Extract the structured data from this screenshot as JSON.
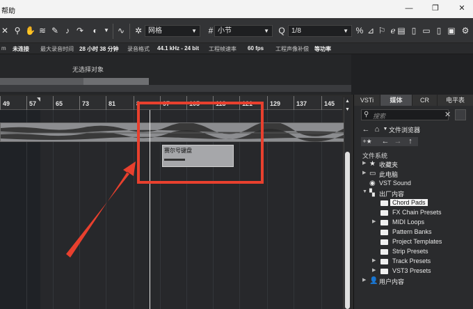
{
  "menubar": {
    "help": "帮助",
    "win_minimize": "—",
    "win_restore": "❐",
    "win_close": "✕"
  },
  "toolbar": {
    "snap_type": "网格",
    "grid_type": "小节",
    "quantize": "1/8"
  },
  "infobar": {
    "items": [
      {
        "label": "m",
        "value": ""
      },
      {
        "label": "未连接",
        "value": ""
      },
      {
        "label": "最大录音时间",
        "value": "28 小时 38 分钟"
      },
      {
        "label": "录音格式",
        "value": "44.1 kHz - 24 bit"
      },
      {
        "label": "工程帧速率",
        "value": "60 fps"
      },
      {
        "label": "工程声像补偿",
        "value": "等功率"
      }
    ]
  },
  "inspector": {
    "no_selection": "无选择对象"
  },
  "ruler": {
    "bars": [
      "49",
      "57",
      "65",
      "73",
      "81",
      "8",
      "97",
      "105",
      "113",
      "121",
      "129",
      "137",
      "145"
    ]
  },
  "arrange": {
    "midi_event_title": "赛尔号键盘"
  },
  "panel": {
    "tabs": [
      "VSTi",
      "媒体",
      "CR",
      "电平表"
    ],
    "search_placeholder": "搜索",
    "path_label": "文件浏览器",
    "section": "文件系统",
    "tree": [
      {
        "label": "收藏夹",
        "icon": "star-icon",
        "expanded": false,
        "level": 0
      },
      {
        "label": "此电脑",
        "icon": "computer-icon",
        "expanded": false,
        "level": 0
      },
      {
        "label": "VST Sound",
        "icon": "disc-icon",
        "expanded": null,
        "level": 0
      },
      {
        "label": "出厂内容",
        "icon": "factory-icon",
        "expanded": true,
        "level": 0
      },
      {
        "label": "Chord Pads",
        "icon": "folder-icon",
        "expanded": null,
        "level": 1,
        "selected": true
      },
      {
        "label": "FX Chain Presets",
        "icon": "folder-icon",
        "expanded": null,
        "level": 1
      },
      {
        "label": "MIDI Loops",
        "icon": "folder-icon",
        "expanded": false,
        "level": 1
      },
      {
        "label": "Pattern Banks",
        "icon": "folder-icon",
        "expanded": null,
        "level": 1
      },
      {
        "label": "Project Templates",
        "icon": "folder-icon",
        "expanded": null,
        "level": 1
      },
      {
        "label": "Strip Presets",
        "icon": "folder-icon",
        "expanded": null,
        "level": 1
      },
      {
        "label": "Track Presets",
        "icon": "folder-icon",
        "expanded": false,
        "level": 1
      },
      {
        "label": "VST3 Presets",
        "icon": "folder-icon",
        "expanded": false,
        "level": 1
      },
      {
        "label": "用户内容",
        "icon": "user-icon",
        "expanded": false,
        "level": 0
      }
    ]
  },
  "colors": {
    "annotation": "#e8402e",
    "selection_bg": "#f4f4f4"
  }
}
